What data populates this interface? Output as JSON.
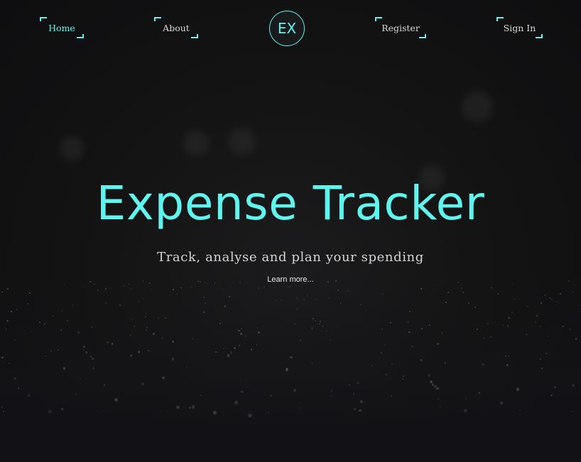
{
  "nav": {
    "items": [
      {
        "label": "Home",
        "active": true
      },
      {
        "label": "About",
        "active": false
      },
      {
        "label": "Register",
        "active": false
      },
      {
        "label": "Sign In",
        "active": false
      }
    ],
    "logo": "EX"
  },
  "hero": {
    "title": "Expense Tracker",
    "subtitle": "Track, analyse and plan your spending",
    "link": "Learn more..."
  },
  "colors": {
    "accent": "#5ff5ee",
    "background": "#141414",
    "text": "#d8d8d8"
  }
}
